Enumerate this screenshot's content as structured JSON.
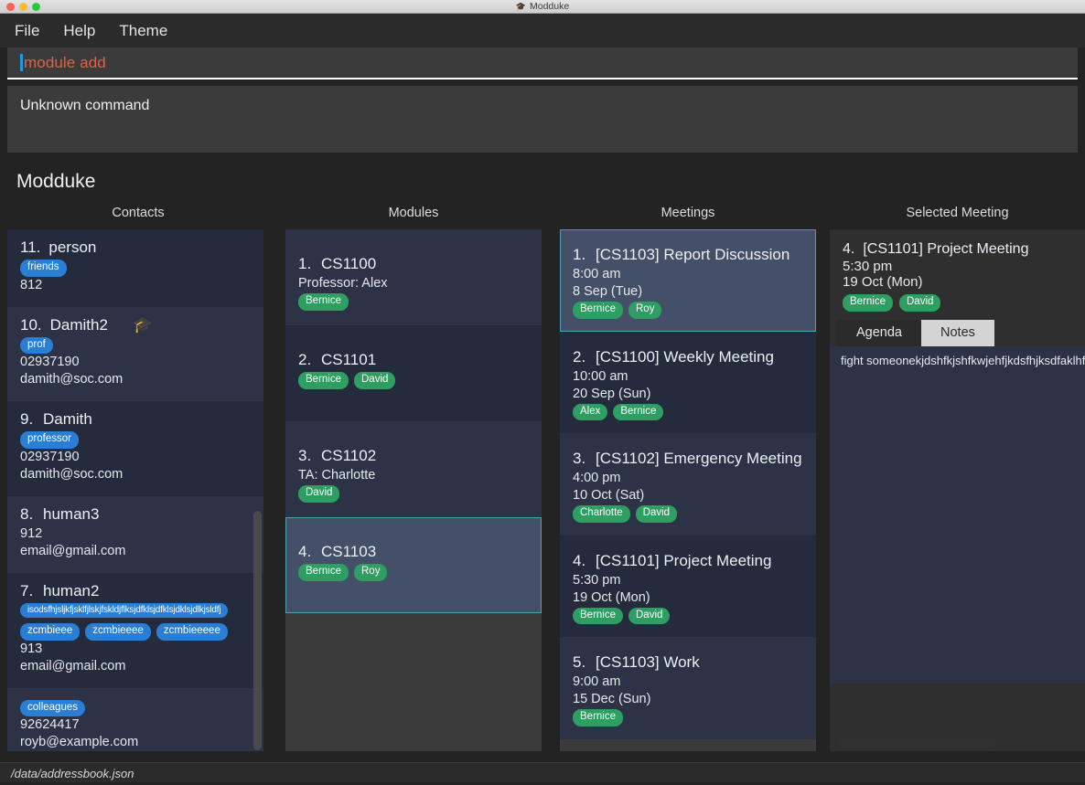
{
  "window": {
    "title": "Modduke",
    "title_icon": "graduation-cap-icon",
    "buttons": {
      "close": "close",
      "minimize": "minimize",
      "maximize": "maximize"
    }
  },
  "menu": {
    "items": [
      "File",
      "Help",
      "Theme"
    ]
  },
  "command": {
    "value": "module add",
    "text_color": "#e0604a",
    "caret_color": "#1f9ae0"
  },
  "result": {
    "text": "Unknown command"
  },
  "app": {
    "title": "Modduke"
  },
  "columns": {
    "contacts_header": "Contacts",
    "modules_header": "Modules",
    "meetings_header": "Meetings",
    "selected_header": "Selected Meeting"
  },
  "contacts": [
    {
      "index": "",
      "name": "",
      "tags": [
        {
          "label": "colleagues",
          "color": "blue"
        }
      ],
      "phone": "92624417",
      "email": "royb@example.com",
      "emoji": "",
      "selected": false,
      "partial": true
    },
    {
      "index": "7.",
      "name": "human2",
      "tags": [
        {
          "label": "isodsfhjsljkfjsklfjlskjfskldjflksjdfklsjdfklsjdklsjdlkjsldfj",
          "color": "blue",
          "wide": true
        },
        {
          "label": "zcmbieee",
          "color": "blue"
        },
        {
          "label": "zcmbieeee",
          "color": "blue"
        },
        {
          "label": "zcmbieeeee",
          "color": "blue"
        }
      ],
      "phone": "913",
      "email": "email@gmail.com",
      "emoji": "",
      "selected": false
    },
    {
      "index": "8.",
      "name": "human3",
      "tags": [],
      "phone": "912",
      "email": "email@gmail.com",
      "emoji": "",
      "selected": false
    },
    {
      "index": "9.",
      "name": "Damith",
      "tags": [
        {
          "label": "professor",
          "color": "blue"
        }
      ],
      "phone": "02937190",
      "email": "damith@soc.com",
      "emoji": "",
      "selected": false
    },
    {
      "index": "10.",
      "name": "Damith2",
      "tags": [
        {
          "label": "prof",
          "color": "blue"
        }
      ],
      "phone": "02937190",
      "email": "damith@soc.com",
      "emoji": "🎓",
      "selected": false
    },
    {
      "index": "11.",
      "name": "person",
      "tags": [
        {
          "label": "friends",
          "color": "blue"
        }
      ],
      "phone": "812",
      "email": "",
      "emoji": "",
      "selected": false
    }
  ],
  "modules": [
    {
      "index": "1.",
      "code": "CS1100",
      "role": "Professor: Alex",
      "tags": [
        {
          "label": "Bernice",
          "color": "green"
        }
      ],
      "selected": false
    },
    {
      "index": "2.",
      "code": "CS1101",
      "role": "",
      "tags": [
        {
          "label": "Bernice",
          "color": "green"
        },
        {
          "label": "David",
          "color": "green"
        }
      ],
      "selected": false
    },
    {
      "index": "3.",
      "code": "CS1102",
      "role": "TA: Charlotte",
      "tags": [
        {
          "label": "David",
          "color": "green"
        }
      ],
      "selected": false
    },
    {
      "index": "4.",
      "code": "CS1103",
      "role": "",
      "tags": [
        {
          "label": "Bernice",
          "color": "green"
        },
        {
          "label": "Roy",
          "color": "green"
        }
      ],
      "selected": true
    }
  ],
  "meetings": [
    {
      "index": "1.",
      "title": "[CS1103] Report Discussion",
      "time": "8:00 am",
      "date": "8 Sep (Tue)",
      "tags": [
        {
          "label": "Bernice",
          "color": "green"
        },
        {
          "label": "Roy",
          "color": "green"
        }
      ],
      "selected": true
    },
    {
      "index": "2.",
      "title": "[CS1100] Weekly Meeting",
      "time": "10:00 am",
      "date": "20 Sep (Sun)",
      "tags": [
        {
          "label": "Alex",
          "color": "green"
        },
        {
          "label": "Bernice",
          "color": "green"
        }
      ],
      "selected": false
    },
    {
      "index": "3.",
      "title": "[CS1102] Emergency Meeting",
      "time": "4:00 pm",
      "date": "10 Oct (Sat)",
      "tags": [
        {
          "label": "Charlotte",
          "color": "green"
        },
        {
          "label": "David",
          "color": "green"
        }
      ],
      "selected": false
    },
    {
      "index": "4.",
      "title": "[CS1101] Project Meeting",
      "time": "5:30 pm",
      "date": "19 Oct (Mon)",
      "tags": [
        {
          "label": "Bernice",
          "color": "green"
        },
        {
          "label": "David",
          "color": "green"
        }
      ],
      "selected": false
    },
    {
      "index": "5.",
      "title": "[CS1103] Work",
      "time": "9:00 am",
      "date": "15 Dec (Sun)",
      "tags": [
        {
          "label": "Bernice",
          "color": "green"
        }
      ],
      "selected": false
    }
  ],
  "selected_meeting": {
    "index": "4.",
    "title": "[CS1101] Project Meeting",
    "time": "5:30 pm",
    "date": "19 Oct (Mon)",
    "tags": [
      {
        "label": "Bernice",
        "color": "green"
      },
      {
        "label": "David",
        "color": "green"
      }
    ],
    "tabs": [
      {
        "label": "Agenda",
        "active": true
      },
      {
        "label": "Notes",
        "active": false
      }
    ],
    "agenda_text": "fight someonekjdshfkjshfkwjehfjkdsfhjksdfaklhfljkdsfhklsjdfh"
  },
  "statusbar": {
    "path": "/data/addressbook.json"
  }
}
